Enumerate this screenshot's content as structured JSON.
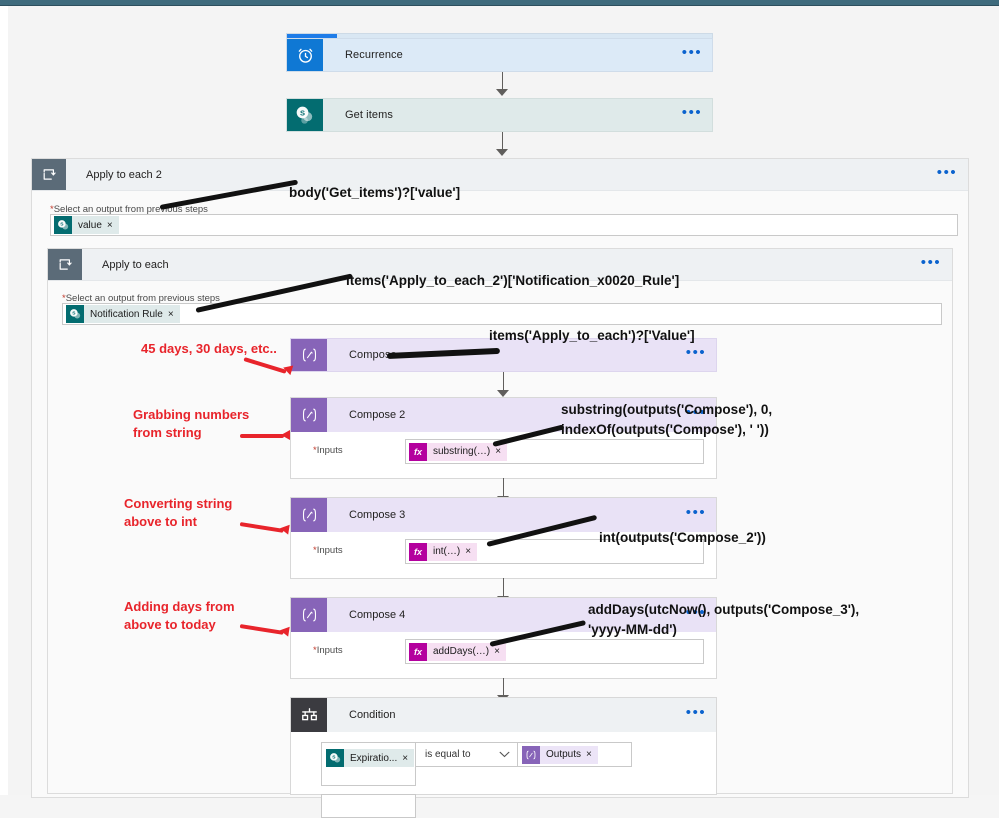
{
  "window": {
    "top_bar_color": "#3f6b7d",
    "canvas_color": "#f4f4f4"
  },
  "progress": {
    "percent": 12,
    "fill_color": "#1e7ce8"
  },
  "flow": {
    "trigger": {
      "title": "Recurrence",
      "icon": "alarm-clock-icon",
      "icon_color": "#0f78d4",
      "overflow": "•••"
    },
    "get_items": {
      "title": "Get items",
      "icon": "sharepoint-icon",
      "icon_color": "#036c70",
      "overflow": "•••"
    },
    "apply_to_each_2": {
      "title": "Apply to each 2",
      "icon": "loop-icon",
      "overflow": "•••",
      "field_label": "Select an output from previous steps",
      "required_marker": "*",
      "token": {
        "text": "value",
        "icon": "sharepoint-icon",
        "remove": "×"
      }
    },
    "apply_to_each": {
      "title": "Apply to each",
      "icon": "loop-icon",
      "overflow": "•••",
      "field_label": "Select an output from previous steps",
      "required_marker": "*",
      "token": {
        "text": "Notification Rule",
        "icon": "sharepoint-icon",
        "remove": "×"
      }
    },
    "compose": {
      "title": "Compose",
      "icon": "compose-icon",
      "icon_color": "#8764b8",
      "overflow": "•••"
    },
    "compose_2": {
      "title": "Compose 2",
      "icon": "compose-icon",
      "overflow": "•••",
      "inputs_label": "Inputs",
      "required_marker": "*",
      "token": {
        "text": "substring(…)",
        "icon": "fx-icon",
        "icon_text": "fx",
        "remove": "×"
      }
    },
    "compose_3": {
      "title": "Compose 3",
      "icon": "compose-icon",
      "overflow": "•••",
      "inputs_label": "Inputs",
      "required_marker": "*",
      "token": {
        "text": "int(…)",
        "icon": "fx-icon",
        "icon_text": "fx",
        "remove": "×"
      }
    },
    "compose_4": {
      "title": "Compose 4",
      "icon": "compose-icon",
      "overflow": "•••",
      "inputs_label": "Inputs",
      "required_marker": "*",
      "token": {
        "text": "addDays(…)",
        "icon": "fx-icon",
        "icon_text": "fx",
        "remove": "×"
      }
    },
    "condition": {
      "title": "Condition",
      "icon": "condition-icon",
      "overflow": "•••",
      "left_token": {
        "text": "Expiratio...",
        "icon": "sharepoint-icon",
        "remove": "×"
      },
      "operator": "is equal to",
      "operator_chevron": "chevron-down-icon",
      "right_token": {
        "text": "Outputs",
        "icon": "compose-icon",
        "remove": "×"
      }
    }
  },
  "annotations": {
    "color_black": "#111111",
    "color_red": "#e8242b",
    "expr_get_items": "body('Get_items')?['value']",
    "expr_notification_rule": "items('Apply_to_each_2')['Notification_x0020_Rule']",
    "expr_compose_value": "items('Apply_to_each')?['Value']",
    "expr_substring_line1": "substring(outputs('Compose'), 0,",
    "expr_substring_line2": "indexOf(outputs('Compose'), ' '))",
    "expr_int": "int(outputs('Compose_2'))",
    "expr_adddays_line1": "addDays(utcNow(), outputs('Compose_3'),",
    "expr_adddays_line2": "'yyyy-MM-dd')",
    "note_days_line1": "45 days, 30 days, etc..",
    "note_grabbing_line1": "Grabbing numbers",
    "note_grabbing_line2": "from string",
    "note_converting_line1": "Converting string",
    "note_converting_line2": "above to int",
    "note_adding_line1": "Adding days from",
    "note_adding_line2": "above to today"
  }
}
